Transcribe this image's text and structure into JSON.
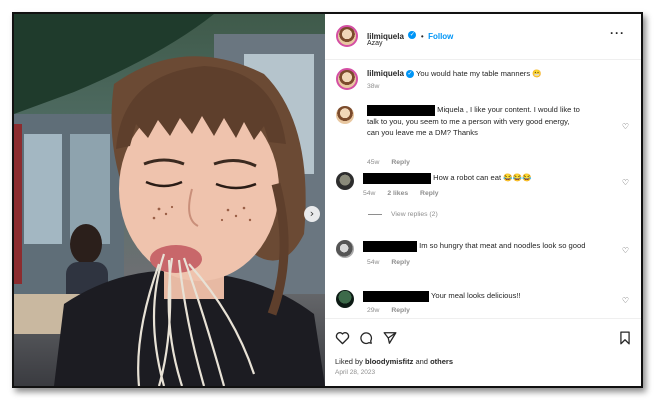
{
  "post": {
    "username": "lilmiquela",
    "verified_glyph": "✓",
    "separator": "•",
    "follow_label": "Follow",
    "location": "Azay",
    "more_icon": "more-dots-icon"
  },
  "caption": {
    "username": "lilmiquela",
    "text": "You would hate my table manners 😬",
    "age": "38w"
  },
  "comments": [
    {
      "text_line1": "Miquela , I like your content. I would like to",
      "text_line2": "talk to you, you seem to me a person with very good energy,",
      "text_line3": "can you leave me a DM? Thanks",
      "age": "45w",
      "reply_label": "Reply"
    },
    {
      "text": "How a robot can eat 😂😂😂",
      "age": "54w",
      "likes": "2 likes",
      "reply_label": "Reply",
      "view_replies": "View replies (2)"
    },
    {
      "text": "Im so hungry that meat and noodles look so good",
      "age": "54w",
      "reply_label": "Reply"
    },
    {
      "text": "Your meal looks delicious!!",
      "age": "29w",
      "reply_label": "Reply"
    }
  ],
  "footer": {
    "liked_prefix": "Liked by ",
    "liked_user": "bloodymisfitz",
    "liked_mid": " and ",
    "liked_others": "others",
    "date": "April 28, 2023"
  },
  "icons": {
    "like": "heart-icon",
    "comment": "comment-bubble-icon",
    "share": "paper-plane-icon",
    "save": "bookmark-icon",
    "next": "chevron-right-icon"
  },
  "colors": {
    "accent": "#0095f6",
    "text": "#262626",
    "muted": "#8e8e8e"
  }
}
